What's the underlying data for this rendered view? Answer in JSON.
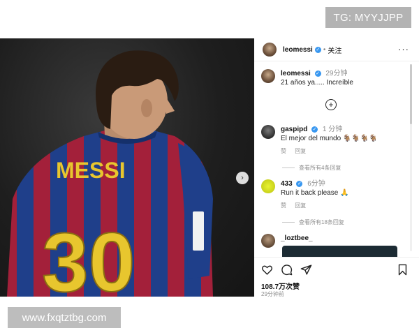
{
  "watermark_top": "TG: MYYJJPP",
  "watermark_bottom": "www.fxqtztbg.com",
  "photo": {
    "jersey_name": "MESSI",
    "jersey_number": "30"
  },
  "header": {
    "username": "leomessi",
    "separator": "•",
    "follow_label": "关注",
    "more_label": "···"
  },
  "caption": {
    "username": "leomessi",
    "time": "29分钟",
    "text": "21 años ya..... Increíble"
  },
  "add_comment_label": "+",
  "comments": [
    {
      "username": "gaspipd",
      "time": "1 分钟",
      "text": "El mejor del mundo 🐐🐐🐐🐐",
      "like_label": "赞",
      "reply_label": "回复",
      "view_replies": "查看所有4条回复"
    },
    {
      "username": "433",
      "time": "6分钟",
      "text": "Run it back please 🙏",
      "like_label": "赞",
      "reply_label": "回复",
      "view_replies": "查看所有18条回复"
    },
    {
      "username": "_loztbee_"
    }
  ],
  "actions": {
    "icons": [
      "heart-icon",
      "comment-icon",
      "share-icon",
      "bookmark-icon"
    ],
    "likes": "108.7万次赞",
    "post_time": "29分钟前"
  },
  "colors": {
    "verified": "#3897f0",
    "secondary_text": "#8e8e8e",
    "jersey_blue": "#1f3f8a",
    "jersey_red": "#a3203a",
    "jersey_yellow": "#e8c62e"
  }
}
